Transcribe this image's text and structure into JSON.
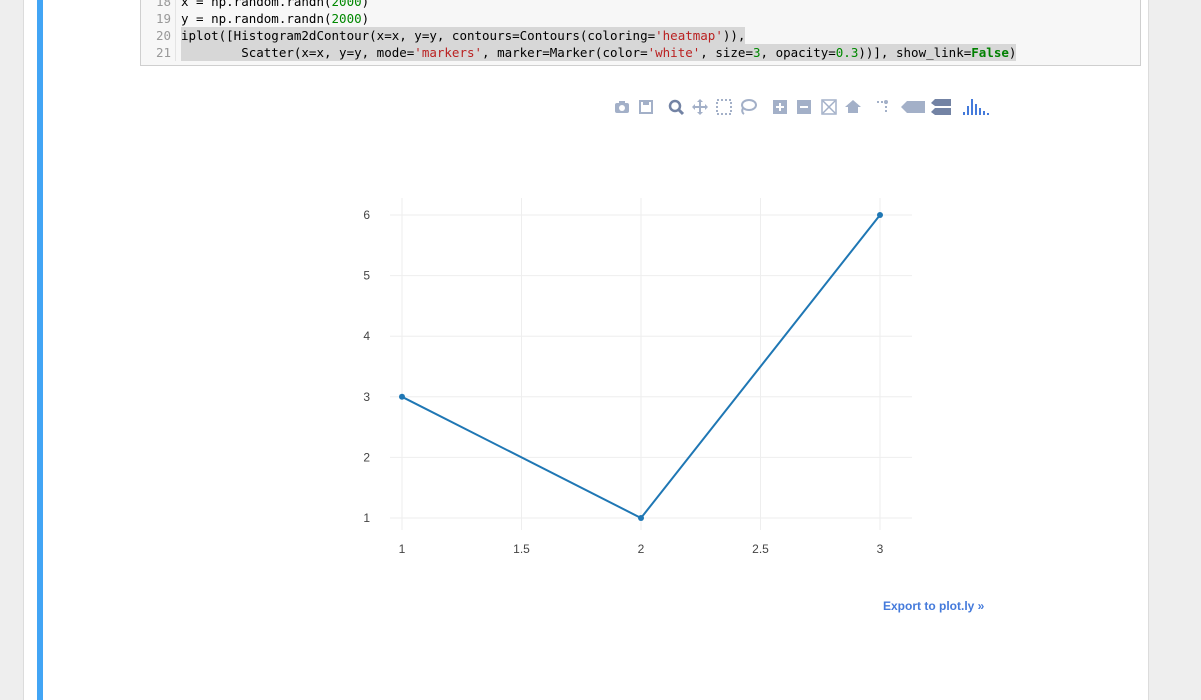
{
  "code_cell": {
    "lines": [
      {
        "num": "18",
        "text": "x = np.random.randn(2000)"
      },
      {
        "num": "19",
        "text": "y = np.random.randn(2000)"
      },
      {
        "num": "20",
        "text": "iplot([Histogram2dContour(x=x, y=y, contours=Contours(coloring='heatmap')),"
      },
      {
        "num": "21",
        "text": "        Scatter(x=x, y=y, mode='markers', marker=Marker(color='white', size=3, opacity=0.3))], show_link=False)"
      }
    ]
  },
  "toolbar": {
    "icons": [
      "camera-icon",
      "save-icon",
      "zoom-icon",
      "pan-icon",
      "box-select-icon",
      "lasso-select-icon",
      "zoom-in-icon",
      "zoom-out-icon",
      "autoscale-icon",
      "reset-axes-icon",
      "spike-lines-icon",
      "hover-closest-icon",
      "hover-compare-icon",
      "plotly-logo-icon"
    ]
  },
  "export_link": "Export to plot.ly »",
  "colors": {
    "line": "#1f77b4",
    "selected_bar": "#42a5f5",
    "link": "#447adb",
    "grid": "#eeeeee",
    "tick_text": "#444444"
  },
  "chart_data": {
    "type": "line",
    "x": [
      1,
      2,
      3
    ],
    "y": [
      3,
      1,
      6
    ],
    "mode": "lines+markers",
    "xlim": [
      1,
      3
    ],
    "ylim": [
      1,
      6
    ],
    "xticks": [
      "1",
      "1.5",
      "2",
      "2.5",
      "3"
    ],
    "yticks": [
      "1",
      "2",
      "3",
      "4",
      "5",
      "6"
    ],
    "grid": true
  }
}
